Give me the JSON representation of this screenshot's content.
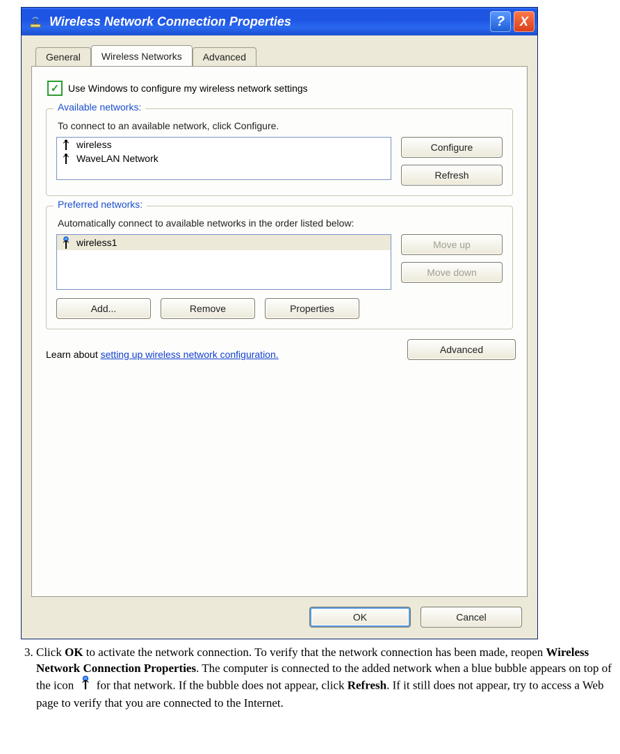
{
  "window": {
    "title": "Wireless Network Connection Properties",
    "help_symbol": "?",
    "close_symbol": "X"
  },
  "tabs": {
    "general": "General",
    "wireless": "Wireless Networks",
    "advanced_tab": "Advanced"
  },
  "checkbox": {
    "label": "Use Windows to configure my wireless network settings",
    "checked_mark": "✓"
  },
  "available": {
    "legend": "Available networks:",
    "desc": "To connect to an available network, click Configure.",
    "items": [
      "wireless",
      "WaveLAN Network"
    ],
    "configure_btn": "Configure",
    "refresh_btn": "Refresh"
  },
  "preferred": {
    "legend": "Preferred networks:",
    "desc": "Automatically connect to available networks in the order listed below:",
    "items": [
      "wireless1"
    ],
    "moveup_btn": "Move up",
    "movedown_btn": "Move down",
    "add_btn": "Add...",
    "remove_btn": "Remove",
    "properties_btn": "Properties"
  },
  "learn": {
    "prefix": "Learn about ",
    "link": "setting up wireless network configuration."
  },
  "advanced_btn": "Advanced",
  "dialog_buttons": {
    "ok": "OK",
    "cancel": "Cancel"
  },
  "instruction": {
    "number": "3.",
    "t1": "Click ",
    "b1": "OK",
    "t2": " to activate the network connection. To verify that the network connection has been made, reopen ",
    "b2": "Wireless Network Connection Properties",
    "t3": ". The computer is connected to the added network when a blue bubble appears on top of the icon ",
    "t4": " for that network. If the bubble does not appear, click ",
    "b3": "Refresh",
    "t5": ". If it still does not appear, try to access a Web page to verify that you are connected to the Internet."
  }
}
